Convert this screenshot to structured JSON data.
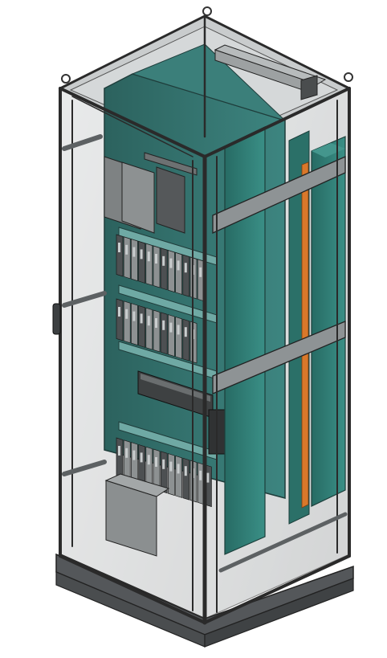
{
  "scene": {
    "subject": "cabinet-3d-view",
    "background": "#ffffff",
    "colors": {
      "frame_dark": "#3a3a3a",
      "frame_mid": "#6b6b6b",
      "glass": "#b9bcbd",
      "glass_light": "#d3d6d7",
      "panel_teal": "#2f6a66",
      "panel_teal_light": "#3f8a84",
      "duct_teal": "#2d7b73",
      "module_gray": "#8a8d8e",
      "module_dark": "#4a4c4d",
      "orange_strip": "#d77a2a",
      "mount_rail": "#8f9496",
      "base": "#5b5e60"
    }
  },
  "labels": {
    "rail_upper": "",
    "rail_lower": ""
  }
}
